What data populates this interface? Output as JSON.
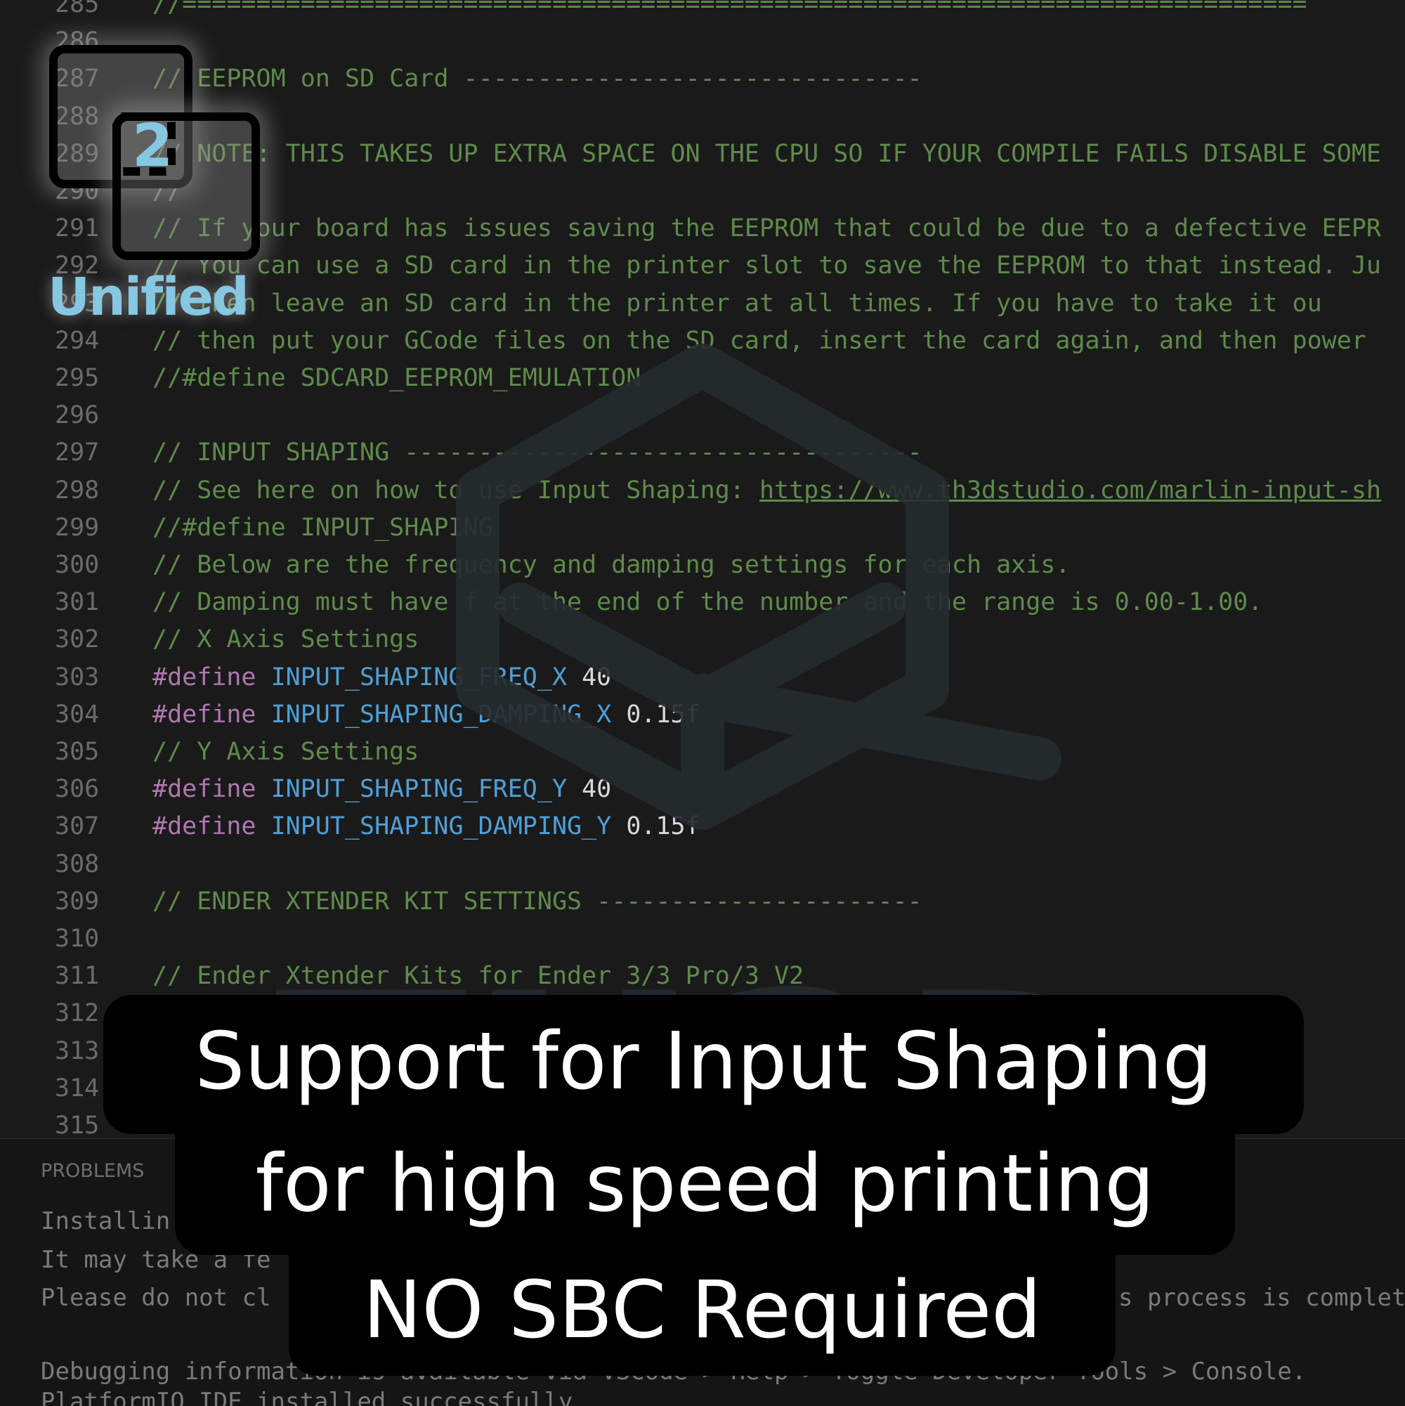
{
  "colors": {
    "background": "#1a1a1a",
    "comment": "#5f8a4c",
    "keyword": "#b077b0",
    "identifier": "#4f9fd6",
    "number": "#d8d8d8",
    "logo_accent": "#86c8e2",
    "caption_bg": "#000000",
    "caption_text": "#ffffff"
  },
  "logo": {
    "number": "2",
    "word": "Unified",
    "icon": "dual-squares-logo-icon"
  },
  "watermark": {
    "text": "TH3D",
    "icon": "cube-logo-icon"
  },
  "editor": {
    "lines": [
      {
        "n": "285",
        "tokens": [
          {
            "t": "comment",
            "v": "//============================================================================"
          }
        ]
      },
      {
        "n": "286",
        "tokens": []
      },
      {
        "n": "287",
        "tokens": [
          {
            "t": "comment",
            "v": "// EEPROM on SD Card -------------------------------"
          }
        ]
      },
      {
        "n": "288",
        "tokens": []
      },
      {
        "n": "289",
        "tokens": [
          {
            "t": "comment",
            "v": "// NOTE: THIS TAKES UP EXTRA SPACE ON THE CPU SO IF YOUR COMPILE FAILS DISABLE SOME"
          }
        ]
      },
      {
        "n": "290",
        "tokens": [
          {
            "t": "comment",
            "v": "//"
          }
        ]
      },
      {
        "n": "291",
        "tokens": [
          {
            "t": "comment",
            "v": "// If your board has issues saving the EEPROM that could be due to a defective EEPR"
          }
        ]
      },
      {
        "n": "292",
        "tokens": [
          {
            "t": "comment",
            "v": "// You can use a SD card in the printer slot to save the EEPROM to that instead. Ju"
          }
        ]
      },
      {
        "n": "293",
        "tokens": [
          {
            "t": "comment",
            "v": "// then leave an SD card in the printer at all times. If you have to take it ou"
          }
        ]
      },
      {
        "n": "294",
        "tokens": [
          {
            "t": "comment",
            "v": "// then put your GCode files on the SD card, insert the card again, and then power"
          }
        ]
      },
      {
        "n": "295",
        "tokens": [
          {
            "t": "comment",
            "v": "//#define SDCARD_EEPROM_EMULATION"
          }
        ]
      },
      {
        "n": "296",
        "tokens": []
      },
      {
        "n": "297",
        "tokens": [
          {
            "t": "comment",
            "v": "// INPUT SHAPING -----------------------------------"
          }
        ]
      },
      {
        "n": "298",
        "tokens": [
          {
            "t": "comment",
            "v": "// See here on how to use Input Shaping: "
          },
          {
            "t": "link",
            "v": "https://www.th3dstudio.com/marlin-input-sh"
          }
        ]
      },
      {
        "n": "299",
        "tokens": [
          {
            "t": "comment",
            "v": "//#define INPUT_SHAPING"
          }
        ]
      },
      {
        "n": "300",
        "tokens": [
          {
            "t": "comment",
            "v": "// Below are the frequency and damping settings for each axis."
          }
        ]
      },
      {
        "n": "301",
        "tokens": [
          {
            "t": "comment",
            "v": "// Damping must have f at the end of the number and the range is 0.00-1.00."
          }
        ]
      },
      {
        "n": "302",
        "tokens": [
          {
            "t": "comment",
            "v": "// X Axis Settings"
          }
        ]
      },
      {
        "n": "303",
        "tokens": [
          {
            "t": "keyword",
            "v": "#define "
          },
          {
            "t": "ident",
            "v": "INPUT_SHAPING_FREQ_X "
          },
          {
            "t": "number",
            "v": "40"
          }
        ]
      },
      {
        "n": "304",
        "tokens": [
          {
            "t": "keyword",
            "v": "#define "
          },
          {
            "t": "ident",
            "v": "INPUT_SHAPING_DAMPING_X "
          },
          {
            "t": "number",
            "v": "0.15f"
          }
        ]
      },
      {
        "n": "305",
        "tokens": [
          {
            "t": "comment",
            "v": "// Y Axis Settings"
          }
        ]
      },
      {
        "n": "306",
        "tokens": [
          {
            "t": "keyword",
            "v": "#define "
          },
          {
            "t": "ident",
            "v": "INPUT_SHAPING_FREQ_Y "
          },
          {
            "t": "number",
            "v": "40"
          }
        ]
      },
      {
        "n": "307",
        "tokens": [
          {
            "t": "keyword",
            "v": "#define "
          },
          {
            "t": "ident",
            "v": "INPUT_SHAPING_DAMPING_Y "
          },
          {
            "t": "number",
            "v": "0.15f"
          }
        ]
      },
      {
        "n": "308",
        "tokens": []
      },
      {
        "n": "309",
        "tokens": [
          {
            "t": "comment",
            "v": "// ENDER XTENDER KIT SETTINGS ----------------------"
          }
        ]
      },
      {
        "n": "310",
        "tokens": []
      },
      {
        "n": "311",
        "tokens": [
          {
            "t": "comment",
            "v": "// Ender Xtender Kits for Ender 3/3 Pro/3 V2"
          }
        ]
      },
      {
        "n": "312",
        "tokens": []
      },
      {
        "n": "313",
        "tokens": []
      },
      {
        "n": "314",
        "tokens": []
      },
      {
        "n": "315",
        "tokens": []
      }
    ]
  },
  "panel": {
    "tab": "PROBLEMS",
    "lines": [
      {
        "left": "Installin",
        "right": ""
      },
      {
        "left": "It may take a fe",
        "right": ""
      },
      {
        "left": "Please do not cl",
        "right": "s process is complet"
      },
      {
        "left": "",
        "right": ""
      },
      {
        "left": "Debugging information is available via VSCode > Help > Toggle Developer Tools > Console.",
        "right": ""
      },
      {
        "left": "PlatformIO IDE installed successfully",
        "right": ""
      }
    ]
  },
  "caption": {
    "line1": "Support for Input Shaping",
    "line2": "for high speed printing",
    "line3": "NO SBC Required"
  }
}
